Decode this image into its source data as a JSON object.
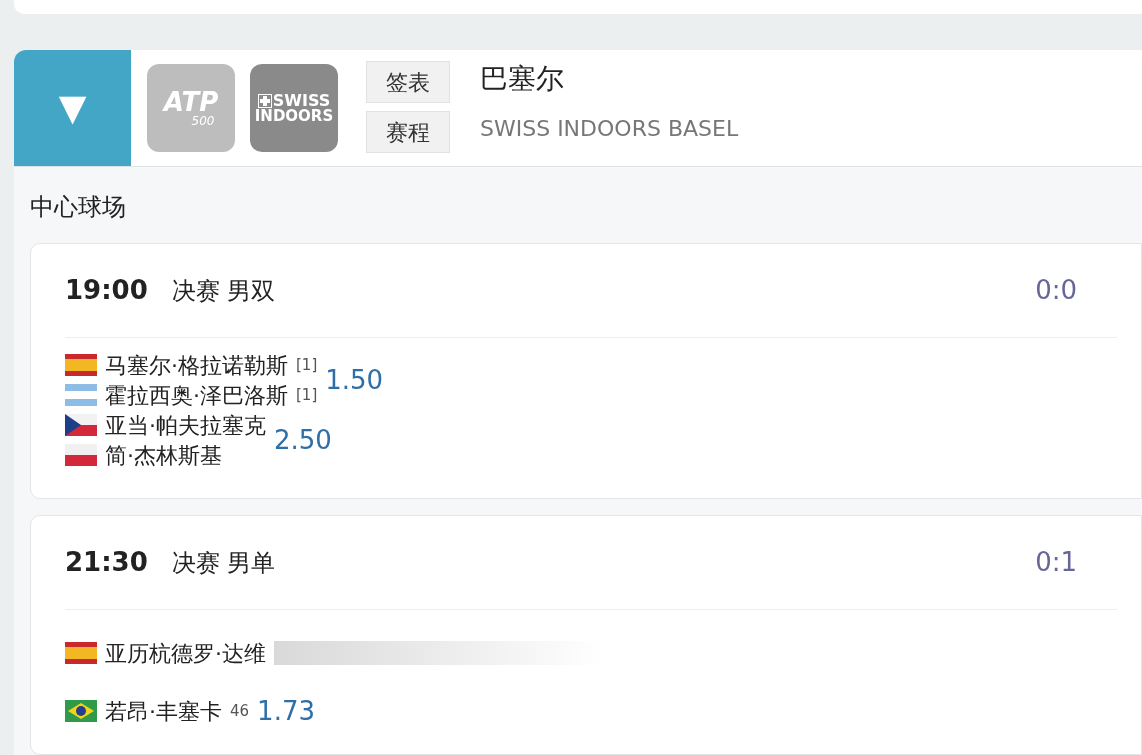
{
  "tournament": {
    "collapse_icon": "▼",
    "logos": [
      {
        "kind": "atp",
        "text": "ATP",
        "sub": "500"
      },
      {
        "kind": "event",
        "text": "SWISS",
        "sub": "INDOORS"
      }
    ],
    "buttons": [
      "签表",
      "赛程"
    ],
    "title": "巴塞尔",
    "subtitle": "SWISS INDOORS BASEL"
  },
  "court": "中心球场",
  "matches": [
    {
      "time": "19:00",
      "round": "决赛 男双",
      "score": "0:0",
      "kind": "doubles",
      "teams": [
        {
          "players": [
            {
              "name": "马塞尔·格拉诺勒斯",
              "kind": "es",
              "seed": "[1]"
            },
            {
              "name": "霍拉西奥·泽巴洛斯",
              "kind": "ar",
              "seed": "[1]"
            }
          ],
          "odds": "1.50",
          "obscured": false
        },
        {
          "players": [
            {
              "name": "亚当·帕夫拉塞克",
              "kind": "cz"
            },
            {
              "name": "简·杰林斯基",
              "kind": "pl"
            }
          ],
          "odds": "2.50",
          "obscured": false
        }
      ]
    },
    {
      "time": "21:30",
      "round": "决赛 男单",
      "score": "0:1",
      "kind": "singles",
      "teams": [
        {
          "players": [
            {
              "name": "亚历杭德罗·达维",
              "kind": "es"
            }
          ],
          "obscured": true
        },
        {
          "players": [
            {
              "name": "若昂·丰塞卡",
              "kind": "br",
              "seed": "46"
            }
          ],
          "odds": "1.73",
          "obscured": false
        }
      ]
    }
  ]
}
